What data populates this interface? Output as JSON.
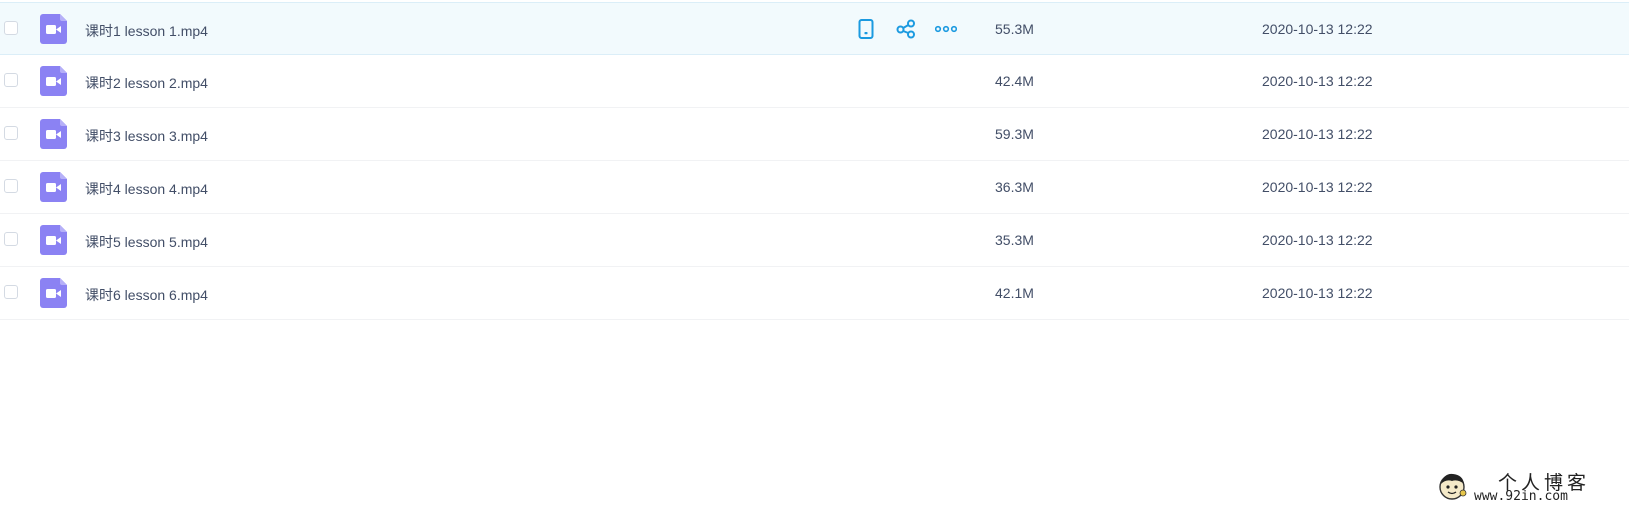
{
  "colors": {
    "video_icon": "#8b82f3",
    "action_icon": "#1b9ae0",
    "hover_row": "#f2fafd",
    "text": "#424e67"
  },
  "files": [
    {
      "name": "课时1 lesson 1.mp4",
      "size": "55.3M",
      "date": "2020-10-13 12:22",
      "icon": "video-file-icon"
    },
    {
      "name": "课时2 lesson 2.mp4",
      "size": "42.4M",
      "date": "2020-10-13 12:22",
      "icon": "video-file-icon"
    },
    {
      "name": "课时3 lesson 3.mp4",
      "size": "59.3M",
      "date": "2020-10-13 12:22",
      "icon": "video-file-icon"
    },
    {
      "name": "课时4 lesson 4.mp4",
      "size": "36.3M",
      "date": "2020-10-13 12:22",
      "icon": "video-file-icon"
    },
    {
      "name": "课时5 lesson 5.mp4",
      "size": "35.3M",
      "date": "2020-10-13 12:22",
      "icon": "video-file-icon"
    },
    {
      "name": "课时6 lesson 6.mp4",
      "size": "42.1M",
      "date": "2020-10-13 12:22",
      "icon": "video-file-icon"
    }
  ],
  "row_actions": [
    "phone-icon",
    "share-icon",
    "more-icon"
  ],
  "watermark": {
    "title": "个人博客",
    "url": "www.92in.com"
  }
}
